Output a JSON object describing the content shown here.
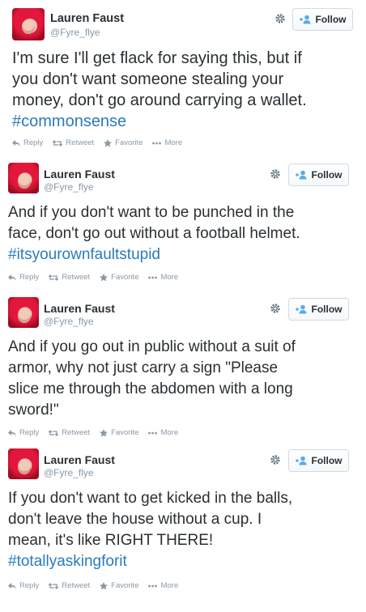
{
  "user": {
    "name": "Lauren Faust",
    "handle": "@Fyre_flye",
    "follow_label": "Follow"
  },
  "actions": {
    "reply": "Reply",
    "retweet": "Retweet",
    "favorite": "Favorite",
    "more": "More"
  },
  "tweets": [
    {
      "lines": [
        "I'm sure I'll get flack for saying this, but if",
        "you don't want someone stealing your",
        "money, don't go around carrying a wallet."
      ],
      "hashtag": "#commonsense"
    },
    {
      "lines": [
        "And if you don't want to be punched in the",
        "face, don't go out without a football helmet."
      ],
      "hashtag": "#itsyourownfaultstupid"
    },
    {
      "lines": [
        "And if you go out in public without a suit of",
        "armor, why not just carry a sign \"Please",
        "slice me through the abdomen with a long",
        "sword!\""
      ],
      "hashtag": ""
    },
    {
      "lines": [
        "If you don't want to get kicked in the balls,",
        "don't leave the house without a cup. I",
        "mean, it's like RIGHT THERE!"
      ],
      "hashtag": "#totallyaskingforit"
    }
  ],
  "colors": {
    "text": "#292f33",
    "muted": "#8899a6",
    "link": "#2b7bb9",
    "follow_icon": "#55acee"
  },
  "icons": {
    "gear": "gear-icon",
    "follow": "follow-person-icon",
    "reply": "reply-icon",
    "retweet": "retweet-icon",
    "favorite": "star-icon",
    "more": "ellipsis-icon"
  }
}
